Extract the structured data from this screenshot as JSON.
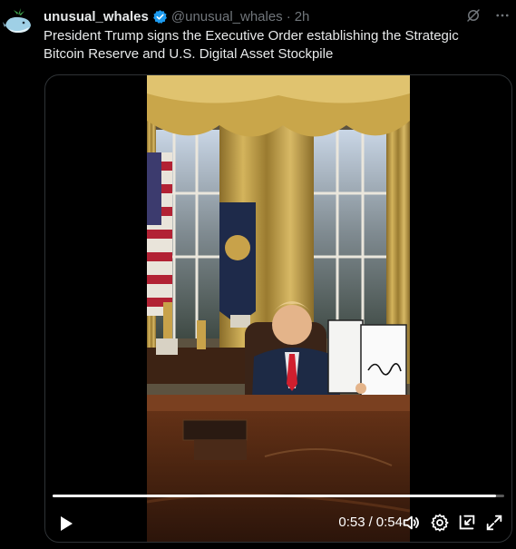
{
  "tweet": {
    "display_name": "unusual_whales",
    "handle": "@unusual_whales",
    "separator": "·",
    "time": "2h",
    "text": "President Trump signs the Executive Order establishing the Strategic Bitcoin Reserve and U.S. Digital Asset Stockpile"
  },
  "header_icons": [
    "grok-icon",
    "more-icon"
  ],
  "video": {
    "current_time": "0:53",
    "separator": "/",
    "duration": "0:54",
    "progress": 0.981
  },
  "colors": {
    "background": "#000000",
    "text": "#e7e9ea",
    "muted": "#71767b",
    "verified": "#1d9bf0"
  }
}
